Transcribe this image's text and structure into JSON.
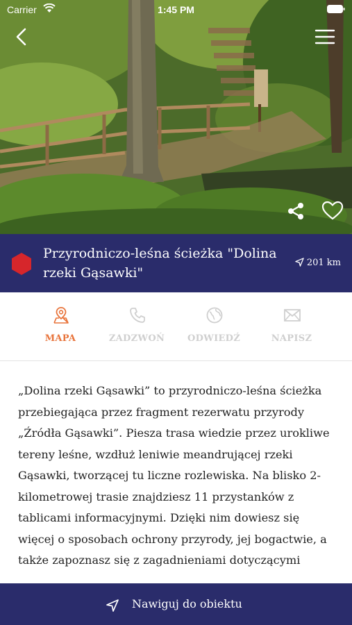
{
  "status_bar": {
    "carrier": "Carrier",
    "time": "1:45 PM"
  },
  "hero": {
    "image_icon": "forest-boardwalk-photo"
  },
  "header": {
    "title": "Przyrodniczo-leśna ścieżka \"Dolina rzeki Gąsawki\"",
    "distance": "201 km",
    "category_color": "#d6262b",
    "bar_color": "#2a2c6b"
  },
  "actions": [
    {
      "label": "MAPA",
      "icon": "map-pin-icon",
      "active": true
    },
    {
      "label": "ZADZWOŃ",
      "icon": "phone-icon",
      "active": false
    },
    {
      "label": "ODWIEDŹ",
      "icon": "globe-icon",
      "active": false
    },
    {
      "label": "NAPISZ",
      "icon": "mail-icon",
      "active": false
    }
  ],
  "colors": {
    "accent": "#e8733a",
    "inactive": "#cfcfcf"
  },
  "description": "„Dolina rzeki Gąsawki” to przyrodniczo-leśna ścieżka przebiegająca przez fragment rezerwatu przyrody „Źródła Gąsawki”. Piesza trasa wiedzie przez urokliwe tereny leśne, wzdłuż leniwie meandrującej rzeki Gąsawki, tworzącej tu liczne rozlewiska. Na blisko 2-kilometrowej trasie znajdziesz 11 przystanków z tablicami informacyjnymi. Dzięki nim dowiesz się więcej o sposobach ochrony przyrody, jej bogactwie, a także zapoznasz się z zagadnieniami dotyczącymi",
  "navigate": {
    "label": "Nawiguj do obiektu"
  }
}
